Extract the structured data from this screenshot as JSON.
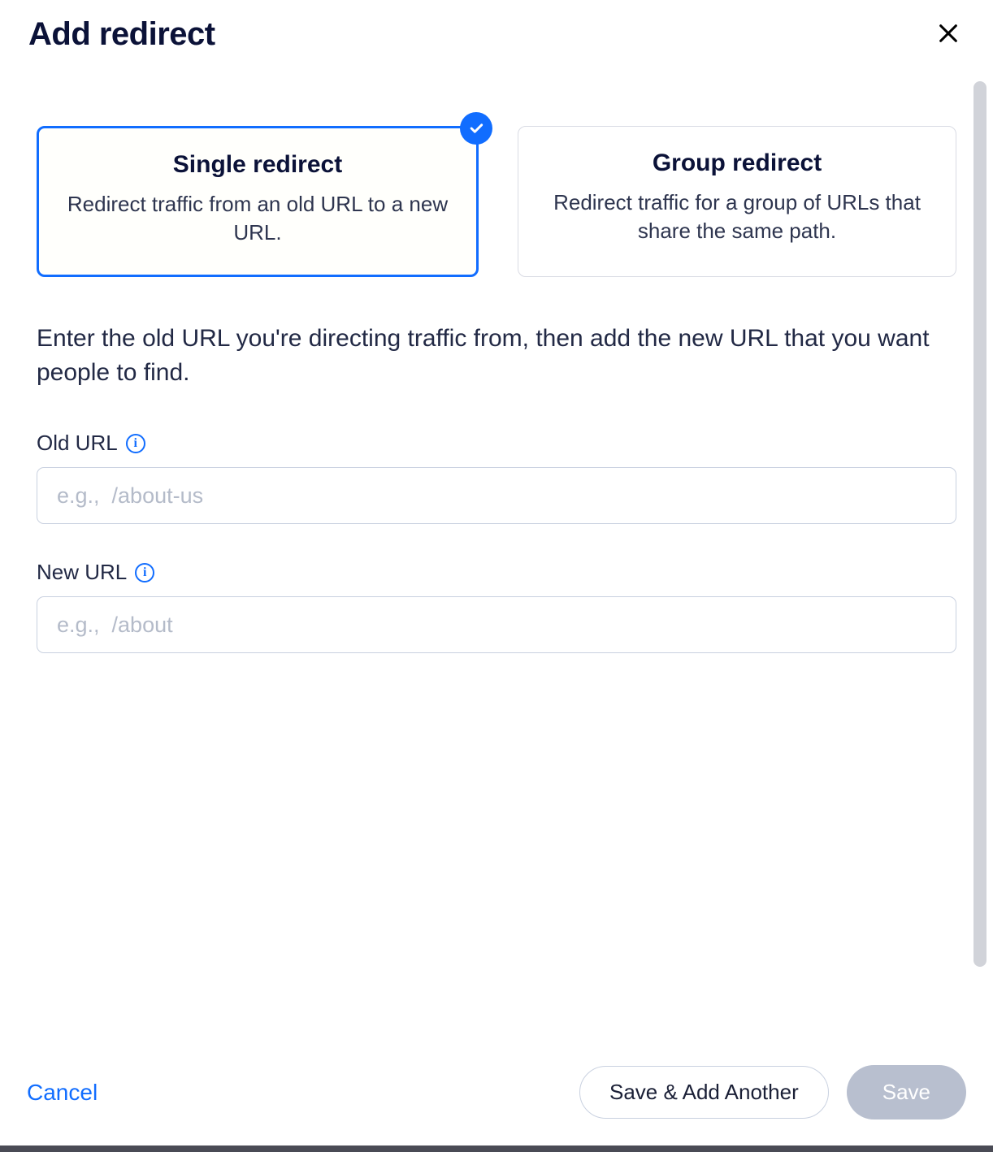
{
  "header": {
    "title": "Add redirect"
  },
  "options": {
    "single": {
      "title": "Single redirect",
      "desc": "Redirect traffic from an old URL to a new URL."
    },
    "group": {
      "title": "Group redirect",
      "desc": "Redirect traffic for a group of URLs that share the same path."
    }
  },
  "instruction": "Enter the old URL you're directing traffic from, then add the new URL that you want people to find.",
  "fields": {
    "oldUrl": {
      "label": "Old URL",
      "placeholder": "e.g.,  /about-us",
      "value": ""
    },
    "newUrl": {
      "label": "New URL",
      "placeholder": "e.g.,  /about",
      "value": ""
    }
  },
  "footer": {
    "cancel": "Cancel",
    "saveAdd": "Save & Add Another",
    "save": "Save"
  }
}
